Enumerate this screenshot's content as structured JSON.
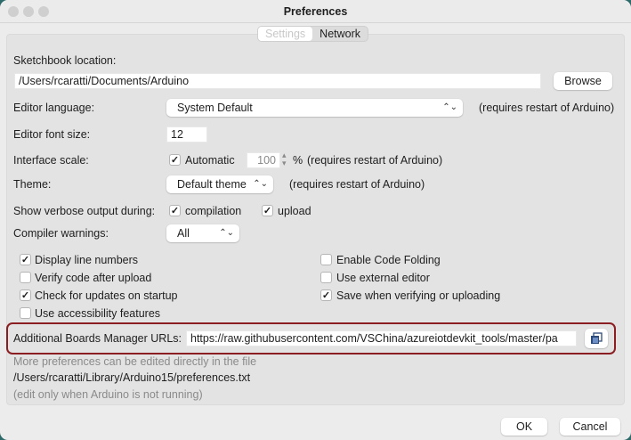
{
  "window": {
    "title": "Preferences"
  },
  "tabs": [
    {
      "label": "Settings"
    },
    {
      "label": "Network"
    }
  ],
  "sketchbook": {
    "label": "Sketchbook location:",
    "value": "/Users/rcaratti/Documents/Arduino",
    "browse": "Browse"
  },
  "language": {
    "label": "Editor language:",
    "value": "System Default",
    "note": "(requires restart of Arduino)"
  },
  "font_size": {
    "label": "Editor font size:",
    "value": "12"
  },
  "scale": {
    "label": "Interface scale:",
    "auto_label": "Automatic",
    "auto_checked": true,
    "value": "100",
    "unit": "%",
    "note": "(requires restart of Arduino)"
  },
  "theme": {
    "label": "Theme:",
    "value": "Default theme",
    "note": "(requires restart of Arduino)"
  },
  "verbose": {
    "label": "Show verbose output during:",
    "compilation": "compilation",
    "upload": "upload"
  },
  "warnings": {
    "label": "Compiler warnings:",
    "value": "All"
  },
  "options_left": [
    {
      "label": "Display line numbers",
      "checked": true
    },
    {
      "label": "Verify code after upload",
      "checked": false
    },
    {
      "label": "Check for updates on startup",
      "checked": true
    },
    {
      "label": "Use accessibility features",
      "checked": false
    }
  ],
  "options_right": [
    {
      "label": "Enable Code Folding",
      "checked": false
    },
    {
      "label": "Use external editor",
      "checked": false
    },
    {
      "label": "Save when verifying or uploading",
      "checked": true
    }
  ],
  "boards": {
    "label": "Additional Boards Manager URLs:",
    "value": "https://raw.githubusercontent.com/VSChina/azureiotdevkit_tools/master/pa"
  },
  "footer": {
    "more": "More preferences can be edited directly in the file",
    "path": "/Users/rcaratti/Library/Arduino15/preferences.txt",
    "edit_note": "(edit only when Arduino is not running)",
    "ok": "OK",
    "cancel": "Cancel"
  },
  "check_glyph": "✓"
}
